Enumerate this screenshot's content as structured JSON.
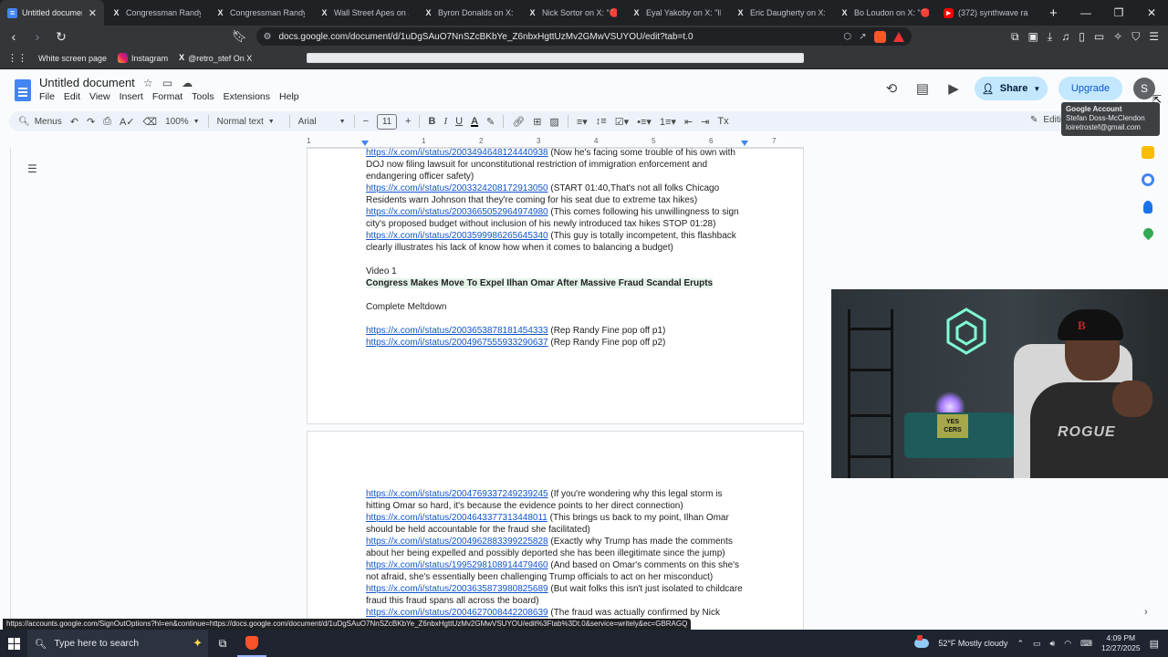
{
  "browser": {
    "tabs": [
      {
        "title": "Untitled document",
        "favicon": "docs-icon",
        "active": true
      },
      {
        "title": "Congressman Randy F",
        "favicon": "x-icon"
      },
      {
        "title": "Congressman Randy F",
        "favicon": "x-icon"
      },
      {
        "title": "Wall Street Apes on X:",
        "favicon": "x-icon"
      },
      {
        "title": "Byron Donalds on X: \"I",
        "favicon": "x-icon"
      },
      {
        "title": "Nick Sortor on X: \"🔴 F",
        "favicon": "x-icon"
      },
      {
        "title": "Eyal Yakoby on X: \"Ilha",
        "favicon": "x-icon"
      },
      {
        "title": "Eric Daugherty on X: \"🔴",
        "favicon": "x-icon"
      },
      {
        "title": "Bo Loudon on X: \"🔴BI",
        "favicon": "x-icon"
      },
      {
        "title": "(372) synthwave ra",
        "favicon": "youtube-icon"
      }
    ],
    "url": "docs.google.com/document/d/1uDgSAuO7NnSZcBKbYe_Z6nbxHgttUzMv2GMwVSUYOU/edit?tab=t.0",
    "bookmarks": [
      {
        "label": "White screen page",
        "icon": "page-icon"
      },
      {
        "label": "Instagram",
        "icon": "instagram-icon"
      },
      {
        "label": "@retro_stef On X",
        "icon": "x-icon"
      }
    ],
    "status_url": "https://accounts.google.com/SignOutOptions?hl=en&continue=https://docs.google.com/document/d/1uDgSAuO7NnSZcBKbYe_Z6nbxHgttUzMv2GMwVSUYOU/edit%3Ftab%3Dt.0&service=writely&ec=GBRAGQ"
  },
  "docs": {
    "title": "Untitled document",
    "menu": [
      "File",
      "Edit",
      "View",
      "Insert",
      "Format",
      "Tools",
      "Extensions",
      "Help"
    ],
    "share_label": "Share",
    "upgrade_label": "Upgrade",
    "avatar_letter": "S",
    "toolbar": {
      "menus_label": "Menus",
      "zoom": "100%",
      "style": "Normal text",
      "font": "Arial",
      "font_size": "11",
      "editing_label": "Editing"
    },
    "tooltip": {
      "title": "Google Account",
      "name": "Stefan Doss-McClendon",
      "email": "loiretrostef@gmail.com"
    },
    "ruler_numbers": [
      "1",
      "1",
      "2",
      "3",
      "4",
      "5",
      "6",
      "7"
    ]
  },
  "page1": {
    "items": [
      {
        "link": "https://x.com/i/status/2003494648124440938",
        "text": " (Now he's facing some trouble of his own with DOJ now filing lawsuit for unconstitutional restriction of immigration enforcement and endangering officer safety)"
      },
      {
        "link": "https://x.com/i/status/2003324208172913050",
        "text": " (START 01:40,That's not all folks Chicago Residents warn Johnson that they're coming for his seat due to extreme tax hikes)"
      },
      {
        "link": "https://x.com/i/status/2003665052964974980",
        "text": " (This comes following his unwillingness to sign city's proposed budget without inclusion of his newly introduced tax hikes STOP 01:28)"
      },
      {
        "link": "https://x.com/i/status/2003599986265645340",
        "text": " (This guy is totally incompetent, this flashback clearly illustrates his lack of know how when it comes to balancing a budget)"
      }
    ],
    "video_label": "Video 1",
    "headline": "Congress Makes Move To Expel Ilhan Omar After Massive Fraud Scandal Erupts",
    "subtitle": "Complete Meltdown",
    "items2": [
      {
        "link": "https://x.com/i/status/2003653878181454333",
        "text": " (Rep Randy Fine pop off p1)"
      },
      {
        "link": "https://x.com/i/status/2004967555933290637",
        "text": " (Rep Randy Fine pop off p2)"
      }
    ]
  },
  "page2": {
    "items": [
      {
        "link": "https://x.com/i/status/2004769337249239245",
        "text": "  (If you're wondering why this legal storm is hitting Omar so hard, it's because the evidence points to her direct connection)"
      },
      {
        "link": "https://x.com/i/status/2004643377313448011",
        "text": " (This brings us back to my point, Ilhan Omar should be held accountable for the fraud she facilitated)"
      },
      {
        "link": "https://x.com/i/status/2004962883399225828",
        "text": " (Exactly why Trump has made the comments about her being expelled and possibly deported she has been illegitimate since the jump)"
      },
      {
        "link": "https://x.com/i/status/1995298108914479460",
        "text": " (And based on Omar's comments on this she's not afraid, she's essentially been challenging Trump officials to act on her misconduct)"
      },
      {
        "link": "https://x.com/i/status/2003635873980825689",
        "text": " (But wait folks this isn't just isolated to childcare fraud this fraud spans all across the board)"
      },
      {
        "link": "https://x.com/i/status/2004627008442208639",
        "text": " (The fraud was actually confirmed by Nick Shirley"
      }
    ]
  },
  "webcam": {
    "pillow_text": "YES CERS",
    "shirt_text": "ROGUE",
    "cap_logo": "B"
  },
  "taskbar": {
    "search_placeholder": "Type here to search",
    "weather": "52°F  Mostly cloudy",
    "time": "4:09 PM",
    "date": "12/27/2025"
  }
}
